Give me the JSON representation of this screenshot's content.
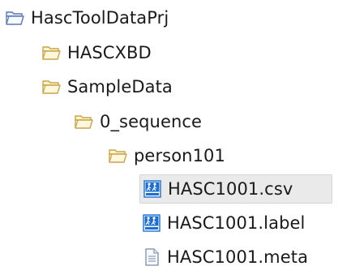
{
  "tree": {
    "project": {
      "label": "HascToolDataPrj",
      "icon": "open-project-folder-icon"
    },
    "folders": [
      {
        "label": "HASCXBD",
        "icon": "open-folder-icon"
      },
      {
        "label": "SampleData",
        "icon": "open-folder-icon"
      },
      {
        "label": "0_sequence",
        "icon": "open-folder-icon"
      },
      {
        "label": "person101",
        "icon": "open-folder-icon"
      }
    ],
    "files": [
      {
        "label": "HASC1001.csv",
        "icon": "hasc-data-file-icon",
        "selected": true
      },
      {
        "label": "HASC1001.label",
        "icon": "hasc-data-file-icon",
        "selected": false
      },
      {
        "label": "HASC1001.meta",
        "icon": "text-file-icon",
        "selected": false
      }
    ]
  },
  "colors": {
    "folder_fill": "#fcf3cf",
    "folder_stroke": "#c8a54a",
    "project_folder_stroke": "#5a78b4",
    "hasc_icon_blue": "#1c6fd0",
    "text_file_stroke": "#7c8ca8"
  }
}
